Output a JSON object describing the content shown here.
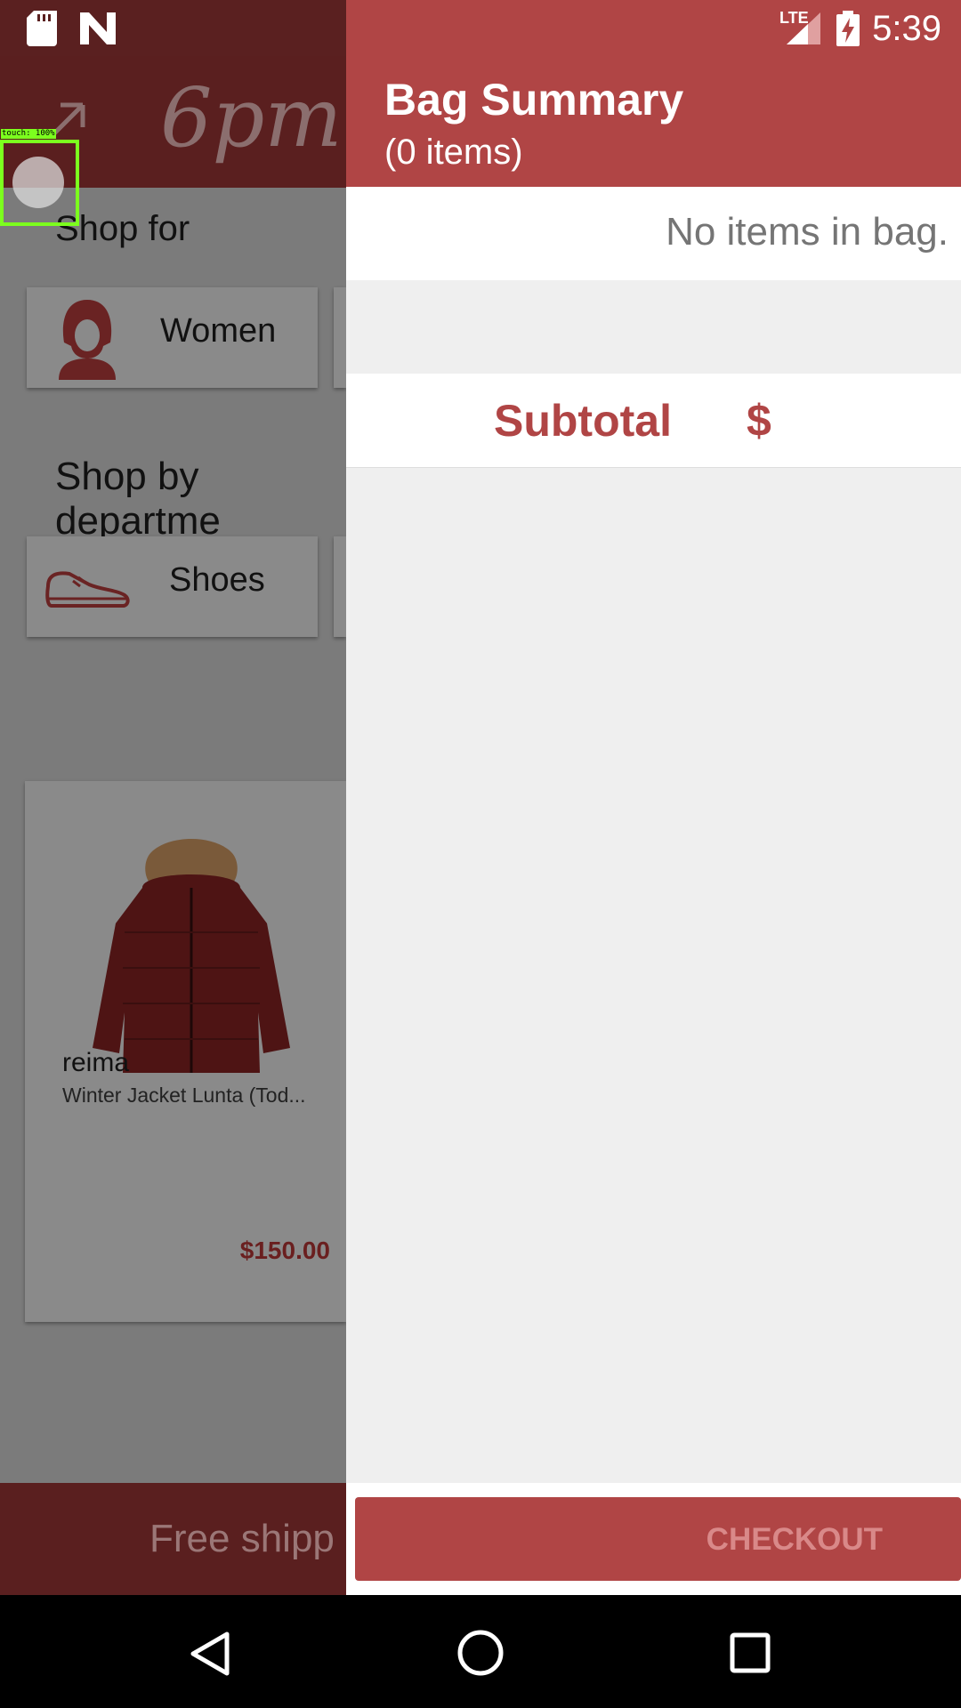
{
  "status_bar": {
    "time": "5:39",
    "network": "LTE",
    "icons": [
      "sd-card-icon",
      "n-icon",
      "lte-signal-icon",
      "battery-charging-icon"
    ]
  },
  "background_app": {
    "logo": "6pm",
    "shop_for_title": "Shop for",
    "women_label": "Women",
    "department_title": "Shop by departme",
    "shoes_label": "Shoes",
    "product": {
      "brand": "reima",
      "name": "Winter Jacket Lunta (Tod...",
      "price": "$150.00"
    },
    "banner_text": "Free shipp"
  },
  "touch_overlay": {
    "label": "touch: 100%"
  },
  "drawer": {
    "title": "Bag Summary",
    "item_count": "(0 items)",
    "empty_message": "No items in bag.",
    "subtotal_label": "Subtotal",
    "subtotal_value": "$",
    "checkout_label": "CHECKOUT"
  },
  "colors": {
    "accent": "#b04545",
    "drawer_bg": "#efefef",
    "touch_box": "#7cff1e"
  }
}
